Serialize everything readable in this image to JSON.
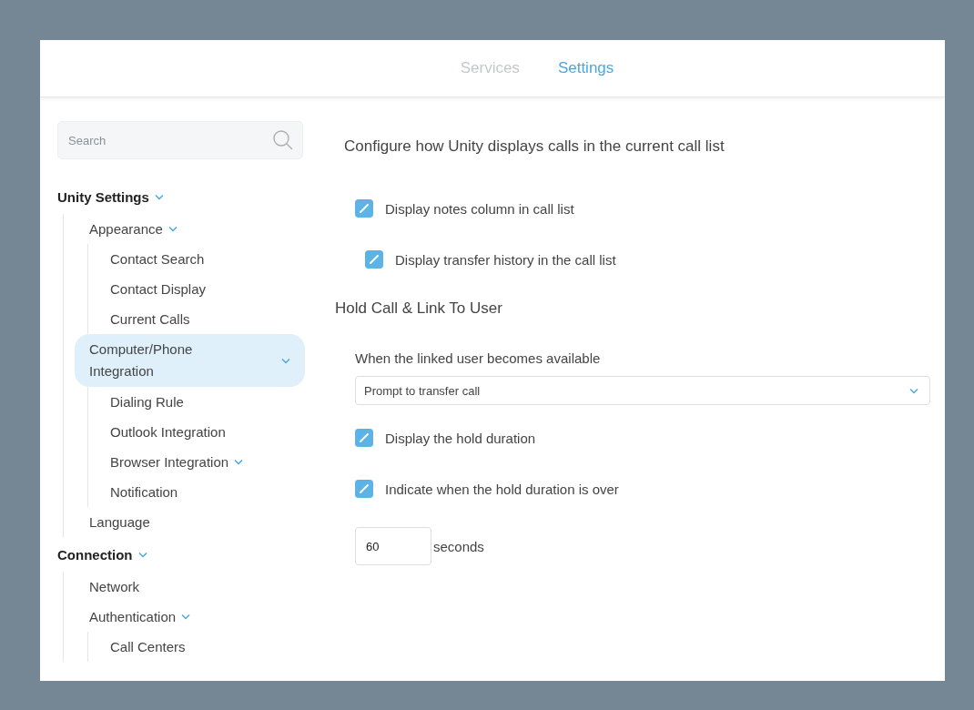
{
  "tabs": [
    {
      "label": "Services",
      "selected": false
    },
    {
      "label": "Settings",
      "selected": true
    }
  ],
  "search": {
    "placeholder": "Search"
  },
  "sidebar": {
    "items": [
      {
        "label": "Unity Settings",
        "expanded": true,
        "selected": false,
        "children": [
          {
            "label": "Appearance",
            "expanded": true,
            "selected": false,
            "children": [
              {
                "label": "Contact Search",
                "selected": false
              },
              {
                "label": "Contact Display",
                "selected": false
              },
              {
                "label": "Current Calls",
                "selected": false
              }
            ]
          },
          {
            "label": "Computer/Phone Integration",
            "expanded": true,
            "selected": true,
            "children": [
              {
                "label": "Dialing Rule",
                "selected": false
              },
              {
                "label": "Outlook Integration",
                "selected": false
              },
              {
                "label": "Browser Integration",
                "expanded": true,
                "selected": false
              },
              {
                "label": "Notification",
                "selected": false
              }
            ]
          },
          {
            "label": "Language",
            "selected": false
          }
        ]
      },
      {
        "label": "Connection",
        "expanded": true,
        "selected": false,
        "children": [
          {
            "label": "Network",
            "selected": false
          },
          {
            "label": "Authentication",
            "expanded": true,
            "selected": false,
            "children": [
              {
                "label": "Call Centers",
                "selected": false
              }
            ]
          }
        ]
      }
    ]
  },
  "content": {
    "title": "Configure how Unity displays calls in the current call list",
    "options": [
      {
        "label": "Display notes column in call list",
        "checked": true,
        "children": [
          {
            "label": "Display transfer history in the call list",
            "checked": true
          }
        ]
      }
    ],
    "section": {
      "title": "Hold Call & Link To User",
      "select_label": "When the linked user becomes available",
      "select_value": "Prompt to transfer call",
      "options": [
        {
          "label": "Display the hold duration",
          "checked": true
        },
        {
          "label": "Indicate when the hold duration is over",
          "checked": true
        }
      ],
      "duration": {
        "value": "60",
        "unit": "seconds"
      }
    }
  }
}
